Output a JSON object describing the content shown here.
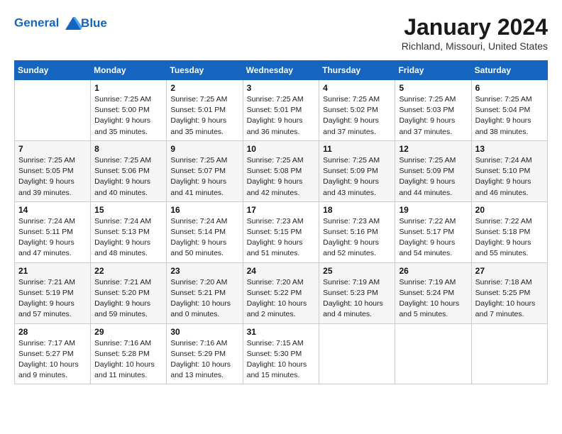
{
  "header": {
    "logo_line1": "General",
    "logo_line2": "Blue",
    "month_year": "January 2024",
    "location": "Richland, Missouri, United States"
  },
  "days_of_week": [
    "Sunday",
    "Monday",
    "Tuesday",
    "Wednesday",
    "Thursday",
    "Friday",
    "Saturday"
  ],
  "weeks": [
    [
      {
        "day": "",
        "info": ""
      },
      {
        "day": "1",
        "info": "Sunrise: 7:25 AM\nSunset: 5:00 PM\nDaylight: 9 hours\nand 35 minutes."
      },
      {
        "day": "2",
        "info": "Sunrise: 7:25 AM\nSunset: 5:01 PM\nDaylight: 9 hours\nand 35 minutes."
      },
      {
        "day": "3",
        "info": "Sunrise: 7:25 AM\nSunset: 5:01 PM\nDaylight: 9 hours\nand 36 minutes."
      },
      {
        "day": "4",
        "info": "Sunrise: 7:25 AM\nSunset: 5:02 PM\nDaylight: 9 hours\nand 37 minutes."
      },
      {
        "day": "5",
        "info": "Sunrise: 7:25 AM\nSunset: 5:03 PM\nDaylight: 9 hours\nand 37 minutes."
      },
      {
        "day": "6",
        "info": "Sunrise: 7:25 AM\nSunset: 5:04 PM\nDaylight: 9 hours\nand 38 minutes."
      }
    ],
    [
      {
        "day": "7",
        "info": "Sunrise: 7:25 AM\nSunset: 5:05 PM\nDaylight: 9 hours\nand 39 minutes."
      },
      {
        "day": "8",
        "info": "Sunrise: 7:25 AM\nSunset: 5:06 PM\nDaylight: 9 hours\nand 40 minutes."
      },
      {
        "day": "9",
        "info": "Sunrise: 7:25 AM\nSunset: 5:07 PM\nDaylight: 9 hours\nand 41 minutes."
      },
      {
        "day": "10",
        "info": "Sunrise: 7:25 AM\nSunset: 5:08 PM\nDaylight: 9 hours\nand 42 minutes."
      },
      {
        "day": "11",
        "info": "Sunrise: 7:25 AM\nSunset: 5:09 PM\nDaylight: 9 hours\nand 43 minutes."
      },
      {
        "day": "12",
        "info": "Sunrise: 7:25 AM\nSunset: 5:09 PM\nDaylight: 9 hours\nand 44 minutes."
      },
      {
        "day": "13",
        "info": "Sunrise: 7:24 AM\nSunset: 5:10 PM\nDaylight: 9 hours\nand 46 minutes."
      }
    ],
    [
      {
        "day": "14",
        "info": "Sunrise: 7:24 AM\nSunset: 5:11 PM\nDaylight: 9 hours\nand 47 minutes."
      },
      {
        "day": "15",
        "info": "Sunrise: 7:24 AM\nSunset: 5:13 PM\nDaylight: 9 hours\nand 48 minutes."
      },
      {
        "day": "16",
        "info": "Sunrise: 7:24 AM\nSunset: 5:14 PM\nDaylight: 9 hours\nand 50 minutes."
      },
      {
        "day": "17",
        "info": "Sunrise: 7:23 AM\nSunset: 5:15 PM\nDaylight: 9 hours\nand 51 minutes."
      },
      {
        "day": "18",
        "info": "Sunrise: 7:23 AM\nSunset: 5:16 PM\nDaylight: 9 hours\nand 52 minutes."
      },
      {
        "day": "19",
        "info": "Sunrise: 7:22 AM\nSunset: 5:17 PM\nDaylight: 9 hours\nand 54 minutes."
      },
      {
        "day": "20",
        "info": "Sunrise: 7:22 AM\nSunset: 5:18 PM\nDaylight: 9 hours\nand 55 minutes."
      }
    ],
    [
      {
        "day": "21",
        "info": "Sunrise: 7:21 AM\nSunset: 5:19 PM\nDaylight: 9 hours\nand 57 minutes."
      },
      {
        "day": "22",
        "info": "Sunrise: 7:21 AM\nSunset: 5:20 PM\nDaylight: 9 hours\nand 59 minutes."
      },
      {
        "day": "23",
        "info": "Sunrise: 7:20 AM\nSunset: 5:21 PM\nDaylight: 10 hours\nand 0 minutes."
      },
      {
        "day": "24",
        "info": "Sunrise: 7:20 AM\nSunset: 5:22 PM\nDaylight: 10 hours\nand 2 minutes."
      },
      {
        "day": "25",
        "info": "Sunrise: 7:19 AM\nSunset: 5:23 PM\nDaylight: 10 hours\nand 4 minutes."
      },
      {
        "day": "26",
        "info": "Sunrise: 7:19 AM\nSunset: 5:24 PM\nDaylight: 10 hours\nand 5 minutes."
      },
      {
        "day": "27",
        "info": "Sunrise: 7:18 AM\nSunset: 5:25 PM\nDaylight: 10 hours\nand 7 minutes."
      }
    ],
    [
      {
        "day": "28",
        "info": "Sunrise: 7:17 AM\nSunset: 5:27 PM\nDaylight: 10 hours\nand 9 minutes."
      },
      {
        "day": "29",
        "info": "Sunrise: 7:16 AM\nSunset: 5:28 PM\nDaylight: 10 hours\nand 11 minutes."
      },
      {
        "day": "30",
        "info": "Sunrise: 7:16 AM\nSunset: 5:29 PM\nDaylight: 10 hours\nand 13 minutes."
      },
      {
        "day": "31",
        "info": "Sunrise: 7:15 AM\nSunset: 5:30 PM\nDaylight: 10 hours\nand 15 minutes."
      },
      {
        "day": "",
        "info": ""
      },
      {
        "day": "",
        "info": ""
      },
      {
        "day": "",
        "info": ""
      }
    ]
  ]
}
